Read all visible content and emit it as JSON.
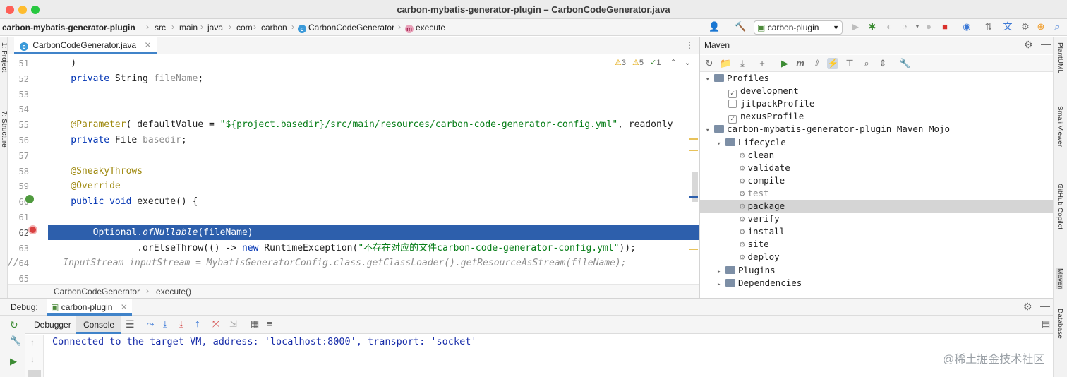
{
  "window": {
    "title": "carbon-mybatis-generator-plugin – CarbonCodeGenerator.java"
  },
  "breadcrumbs": {
    "project": "carbon-mybatis-generator-plugin",
    "items": [
      "src",
      "main",
      "java",
      "com",
      "carbon"
    ],
    "class": "CarbonCodeGenerator",
    "method": "execute"
  },
  "toolbar": {
    "run_config": "carbon-plugin"
  },
  "left_stripe": {
    "project": "1: Project",
    "structure": "7: Structure"
  },
  "editor": {
    "tab": "CarbonCodeGenerator.java",
    "inspections": {
      "warnings": "3",
      "weak_warnings": "5",
      "ok": "1"
    },
    "lines": [
      {
        "num": "51",
        "tokens": [
          {
            "t": "    )",
            "c": ""
          }
        ]
      },
      {
        "num": "52",
        "tokens": [
          {
            "t": "    private ",
            "c": "kw"
          },
          {
            "t": "String ",
            "c": ""
          },
          {
            "t": "fileName",
            "c": "gray"
          },
          {
            "t": ";",
            "c": ""
          }
        ]
      },
      {
        "num": "53",
        "tokens": []
      },
      {
        "num": "54",
        "tokens": []
      },
      {
        "num": "55",
        "tokens": [
          {
            "t": "    @Parameter",
            "c": "ann"
          },
          {
            "t": "( defaultValue = ",
            "c": ""
          },
          {
            "t": "\"${project.basedir}/src/main/resources/carbon-code-generator-config.yml\"",
            "c": "str"
          },
          {
            "t": ", readonly",
            "c": ""
          }
        ]
      },
      {
        "num": "56",
        "tokens": [
          {
            "t": "    private ",
            "c": "kw"
          },
          {
            "t": "File ",
            "c": ""
          },
          {
            "t": "basedir",
            "c": "gray"
          },
          {
            "t": ";",
            "c": ""
          }
        ]
      },
      {
        "num": "57",
        "tokens": []
      },
      {
        "num": "58",
        "tokens": [
          {
            "t": "    @SneakyThrows",
            "c": "ann"
          }
        ]
      },
      {
        "num": "59",
        "tokens": [
          {
            "t": "    @Override",
            "c": "ann"
          }
        ]
      },
      {
        "num": "60",
        "tokens": [
          {
            "t": "    public void ",
            "c": "kw"
          },
          {
            "t": "execute() {",
            "c": ""
          }
        ]
      },
      {
        "num": "61",
        "tokens": []
      },
      {
        "num": "62",
        "tokens": [
          {
            "t": "        Optional.",
            "c": ""
          },
          {
            "t": "ofNullable",
            "c": "ital"
          },
          {
            "t": "(fileName)",
            "c": ""
          }
        ]
      },
      {
        "num": "63",
        "tokens": [
          {
            "t": "                .orElseThrow(() -> ",
            "c": ""
          },
          {
            "t": "new ",
            "c": "kw"
          },
          {
            "t": "RuntimeException(",
            "c": ""
          },
          {
            "t": "\"不存在对应的文件carbon-code-generator-config.yml\"",
            "c": "str"
          },
          {
            "t": "));",
            "c": ""
          }
        ]
      },
      {
        "num": "64",
        "tokens": [
          {
            "t": "//        InputStream inputStream = MybatisGeneratorConfig.class.getClassLoader().getResourceAsStream(fileName);",
            "c": "cmt"
          }
        ]
      },
      {
        "num": "65",
        "tokens": []
      }
    ],
    "footer_breadcrumb": {
      "class": "CarbonCodeGenerator",
      "method": "execute()"
    }
  },
  "maven": {
    "title": "Maven",
    "tree": [
      {
        "label": "Profiles",
        "kind": "folder",
        "indent": 0,
        "arrow": "▾"
      },
      {
        "label": "development",
        "kind": "check",
        "checked": true,
        "indent": 2
      },
      {
        "label": "jitpackProfile",
        "kind": "check",
        "checked": false,
        "indent": 2
      },
      {
        "label": "nexusProfile",
        "kind": "check",
        "checked": true,
        "indent": 2
      },
      {
        "label": "carbon-mybatis-generator-plugin Maven Mojo",
        "kind": "module",
        "indent": 0,
        "arrow": "▾"
      },
      {
        "label": "Lifecycle",
        "kind": "folder",
        "indent": 1,
        "arrow": "▾"
      },
      {
        "label": "clean",
        "kind": "goal",
        "indent": 3
      },
      {
        "label": "validate",
        "kind": "goal",
        "indent": 3
      },
      {
        "label": "compile",
        "kind": "goal",
        "indent": 3
      },
      {
        "label": "test",
        "kind": "goal-skipped",
        "indent": 3
      },
      {
        "label": "package",
        "kind": "goal",
        "indent": 3,
        "selected": true
      },
      {
        "label": "verify",
        "kind": "goal",
        "indent": 3
      },
      {
        "label": "install",
        "kind": "goal",
        "indent": 3
      },
      {
        "label": "site",
        "kind": "goal",
        "indent": 3
      },
      {
        "label": "deploy",
        "kind": "goal",
        "indent": 3
      },
      {
        "label": "Plugins",
        "kind": "folder",
        "indent": 1,
        "arrow": "▸"
      },
      {
        "label": "Dependencies",
        "kind": "folder",
        "indent": 1,
        "arrow": "▸"
      }
    ]
  },
  "right_stripe": [
    "PlantUML",
    "Smali Viewer",
    "GitHub Copilot",
    "Maven",
    "Database"
  ],
  "debug": {
    "label": "Debug:",
    "session": "carbon-plugin",
    "tabs": {
      "debugger": "Debugger",
      "console": "Console"
    },
    "console_text": "Connected to the target VM, address: 'localhost:8000', transport: 'socket'"
  },
  "watermark": "@稀土掘金技术社区",
  "colors": {
    "accent": "#4083c9",
    "selection": "#2d5fac",
    "keyword": "#0033b3",
    "string": "#067d17",
    "annotation": "#9e880d"
  }
}
